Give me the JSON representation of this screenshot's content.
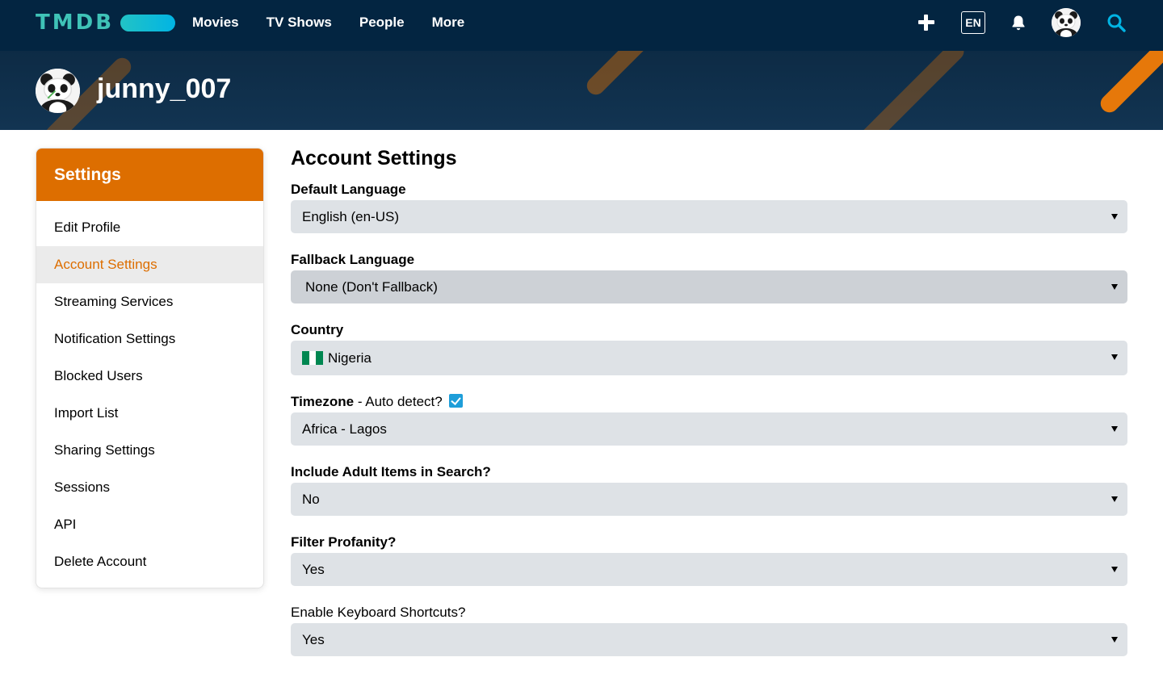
{
  "brand": {
    "logo_text": "TMDB"
  },
  "nav": {
    "items": [
      {
        "label": "Movies"
      },
      {
        "label": "TV Shows"
      },
      {
        "label": "People"
      },
      {
        "label": "More"
      }
    ],
    "language": "EN",
    "icons": [
      "plus-icon",
      "bell-icon",
      "avatar",
      "search-icon"
    ]
  },
  "profile": {
    "username": "junny_007"
  },
  "sidebar": {
    "title": "Settings",
    "items": [
      {
        "label": "Edit Profile"
      },
      {
        "label": "Account Settings",
        "active": true
      },
      {
        "label": "Streaming Services"
      },
      {
        "label": "Notification Settings"
      },
      {
        "label": "Blocked Users"
      },
      {
        "label": "Import List"
      },
      {
        "label": "Sharing Settings"
      },
      {
        "label": "Sessions"
      },
      {
        "label": "API"
      },
      {
        "label": "Delete Account"
      }
    ]
  },
  "main": {
    "title": "Account Settings",
    "fields": {
      "default_language": {
        "label": "Default Language",
        "value": "English (en-US)"
      },
      "fallback_language": {
        "label": "Fallback Language",
        "value": "None (Don't Fallback)"
      },
      "country": {
        "label": "Country",
        "value": "Nigeria",
        "flag_colors": [
          "#008751",
          "#ffffff",
          "#008751"
        ]
      },
      "timezone": {
        "label": "Timezone",
        "auto_label": " - Auto detect?",
        "auto_checked": true,
        "value": "Africa - Lagos"
      },
      "adult": {
        "label": "Include Adult Items in Search?",
        "value": "No"
      },
      "profanity": {
        "label": "Filter Profanity?",
        "value": "Yes"
      },
      "shortcuts": {
        "label": "Enable Keyboard Shortcuts?",
        "value": "Yes"
      }
    }
  },
  "colors": {
    "nav_bg": "#032541",
    "accent_orange": "#dd6e00",
    "logo_teal": "#3fc3b7",
    "search_blue": "#01b4e4",
    "select_bg": "#dee2e6"
  }
}
